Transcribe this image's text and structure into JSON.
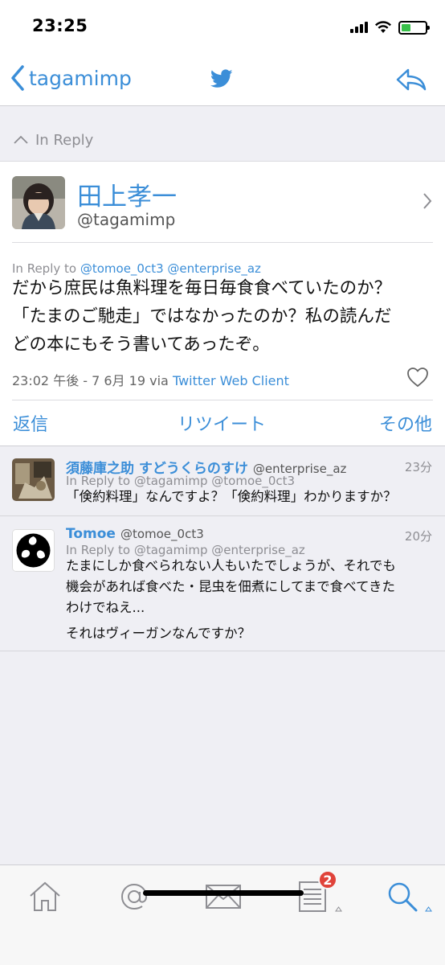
{
  "status": {
    "time": "23:25"
  },
  "nav": {
    "back_label": "tagamimp",
    "logo_icon": "twitter-bird-icon",
    "reply_icon": "reply-arrow-icon"
  },
  "in_reply_bar": {
    "label": "In Reply"
  },
  "tweet": {
    "name": "田上孝一",
    "handle": "@tagamimp",
    "reply_to_prefix": "In Reply to",
    "reply_to_mentions": "@tomoe_0ct3 @enterprise_az",
    "text_lines": [
      "だから庶民は魚料理を毎日毎食食べていたのか？",
      "「たまのご馳走」ではなかったのか？私の読んだ",
      "どの本にもそう書いてあったぞ。"
    ],
    "timestamp": "23:02 午後 - 7 6月 19 via",
    "client": "Twitter Web Client",
    "actions": {
      "reply": "返信",
      "retweet": "リツイート",
      "more": "その他"
    }
  },
  "replies": [
    {
      "name": "須藤庫之助 すどうくらのすけ",
      "handle": "@enterprise_az",
      "time": "23分",
      "reply_to": "In Reply to @tagamimp @tomoe_0ct3",
      "text": "「倹約料理」なんですよ？「倹約料理」わかりますか？"
    },
    {
      "name": "Tomoe",
      "handle": "@tomoe_0ct3",
      "time": "20分",
      "reply_to": "In Reply to @tagamimp @enterprise_az",
      "text_lines": [
        "たまにしか食べられない人もいたでしょうが、それでも",
        "機会があれば食べた・昆虫を佃煮にしてまで食べてきた",
        "わけでねえ..."
      ],
      "text_extra": "それはヴィーガンなんですか？"
    }
  ],
  "tabbar": {
    "messages_badge": "2"
  },
  "colors": {
    "accent": "#3b8ed8",
    "badge": "#e0433a"
  }
}
